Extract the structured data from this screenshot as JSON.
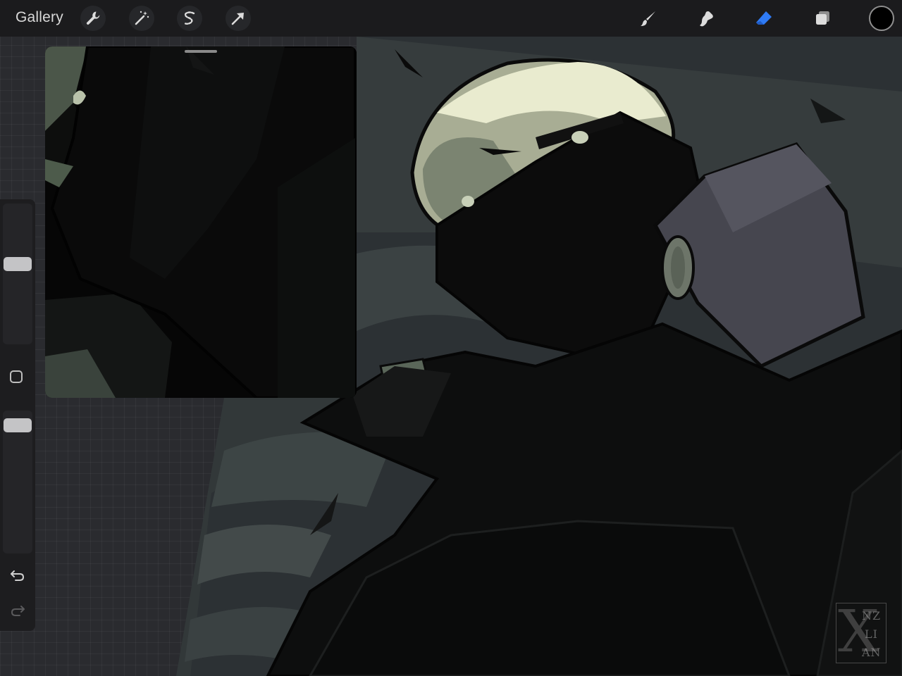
{
  "topbar": {
    "gallery_label": "Gallery",
    "left_tools": [
      "wrench-icon",
      "magic-wand-icon",
      "selection-s-icon",
      "transform-arrow-icon"
    ],
    "right_tools": [
      "brush-icon",
      "smudge-icon",
      "eraser-icon",
      "layers-icon"
    ],
    "active_tool": "eraser-icon",
    "active_color": "#2f7bf5",
    "current_color": "#000000"
  },
  "sidebar": {
    "brush_size_level": 0.42,
    "opacity_level": 0.06,
    "icons": [
      "modify-square-icon",
      "undo-icon",
      "redo-icon"
    ]
  },
  "signature": {
    "line1": "NZ",
    "line2": "LI",
    "line3": "AN"
  }
}
